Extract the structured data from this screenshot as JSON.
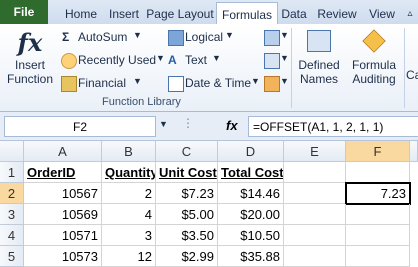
{
  "tabs": {
    "file": "File",
    "items": [
      "Home",
      "Insert",
      "Page Layout",
      "Formulas",
      "Data",
      "Review",
      "View"
    ],
    "active": "Formulas"
  },
  "ribbon": {
    "insert_function": [
      "Insert",
      "Function"
    ],
    "autosum": "AutoSum",
    "recently_used": "Recently Used",
    "financial": "Financial",
    "logical": "Logical",
    "text": "Text",
    "date_time": "Date & Time",
    "defined_names": [
      "Defined",
      "Names"
    ],
    "formula_auditing": [
      "Formula",
      "Auditing"
    ],
    "calculation_partial": "Ca",
    "group_label": "Function Library"
  },
  "formula_bar": {
    "name_box": "F2",
    "fx": "fx",
    "formula": "=OFFSET(A1, 1, 2, 1, 1)"
  },
  "sheet": {
    "columns": [
      "A",
      "B",
      "C",
      "D",
      "E",
      "F"
    ],
    "rows": [
      "1",
      "2",
      "3",
      "4",
      "5"
    ],
    "cells": [
      [
        "OrderID",
        "Quantity",
        "Unit Cost",
        "Total Cost",
        "",
        ""
      ],
      [
        "10567",
        "2",
        "$7.23",
        "$14.46",
        "",
        "7.23"
      ],
      [
        "10569",
        "4",
        "$5.00",
        "$20.00",
        "",
        ""
      ],
      [
        "10571",
        "3",
        "$3.50",
        "$10.50",
        "",
        ""
      ],
      [
        "10573",
        "12",
        "$2.99",
        "$35.88",
        "",
        ""
      ]
    ],
    "selected_cell": "F2"
  },
  "colors": {
    "file_tab": "#2f6b2d",
    "selected_header": "#f9d99f"
  }
}
